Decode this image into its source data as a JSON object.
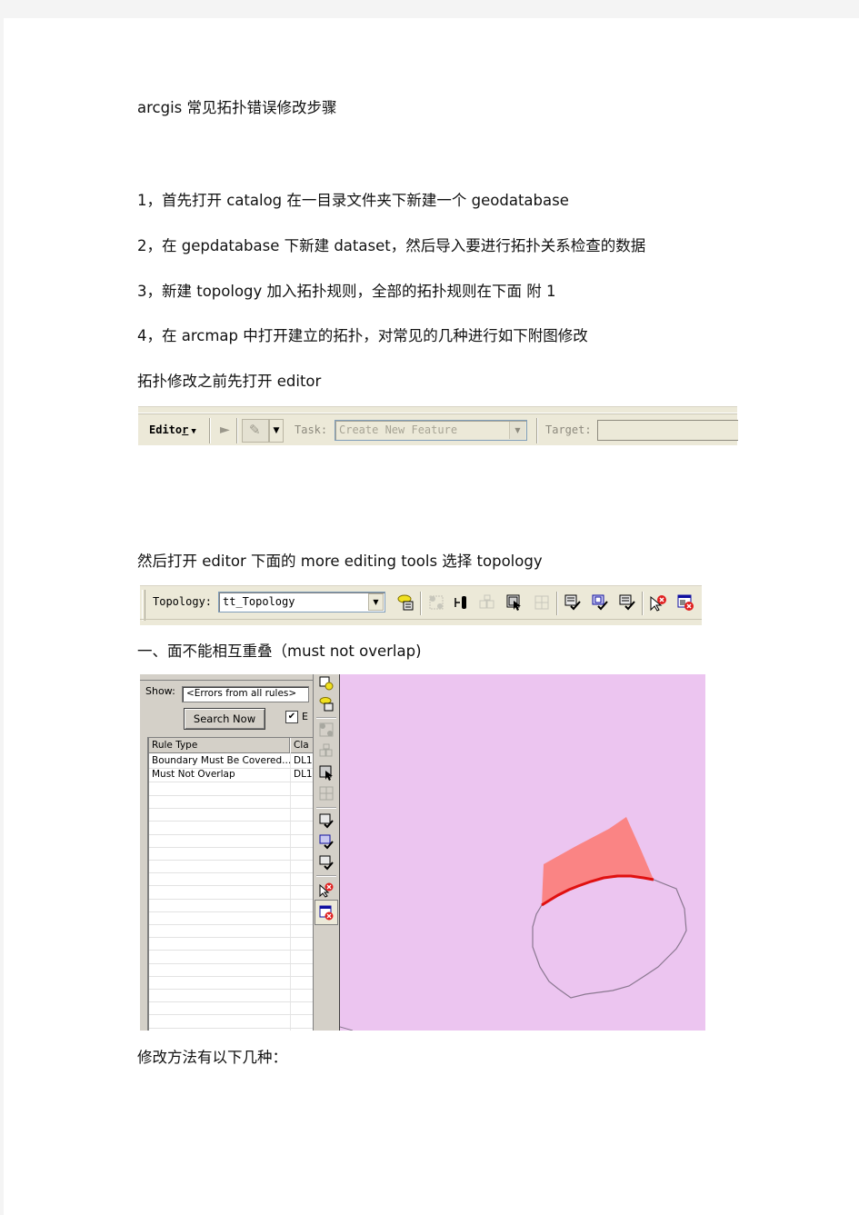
{
  "document": {
    "title": "arcgis 常见拓扑错误修改步骤",
    "steps": [
      "1，首先打开 catalog  在一目录文件夹下新建一个  geodatabase",
      "2，在 gepdatabase 下新建 dataset，然后导入要进行拓扑关系检查的数据",
      "3，新建 topology  加入拓扑规则，全部的拓扑规则在下面  附 1",
      "4，在 arcmap 中打开建立的拓扑，对常见的几种进行如下附图修改"
    ],
    "editor_note": "拓扑修改之前先打开 editor",
    "topology_note": "然后打开 editor 下面的 more  editing  tools 选择 topology",
    "section1_heading": "一、面不能相互重叠（must  not  overlap)",
    "fix_methods_label": "修改方法有以下几种："
  },
  "editor_toolbar": {
    "menu_label": "Editor",
    "menu_underline_char": "r",
    "task_label": "Task:",
    "task_value": "Create New Feature",
    "target_label": "Target:",
    "target_value": "",
    "icons": [
      "edit-tool-arrow-icon",
      "sketch-pencil-icon",
      "dropdown-arrow-icon"
    ]
  },
  "topology_toolbar": {
    "label": "Topology:",
    "selected_topology": "tt_Topology",
    "tools": [
      {
        "name": "map-topology-icon",
        "enabled": true
      },
      {
        "name": "topology-edit-tool-icon",
        "enabled": false
      },
      {
        "name": "show-shared-features-icon",
        "enabled": true
      },
      {
        "name": "construct-features-icon",
        "enabled": false
      },
      {
        "name": "fix-topology-error-icon",
        "enabled": true
      },
      {
        "name": "planarize-lines-icon",
        "enabled": false
      },
      {
        "name": "validate-topology-in-area-icon",
        "enabled": true
      },
      {
        "name": "validate-topology-visible-extent-icon",
        "enabled": true
      },
      {
        "name": "validate-entire-topology-icon",
        "enabled": true
      },
      {
        "name": "fix-error-tool-icon",
        "enabled": true
      },
      {
        "name": "error-inspector-icon",
        "enabled": true
      }
    ]
  },
  "error_inspector": {
    "show_label": "Show:",
    "show_value": "<Errors from all rules>",
    "search_button": "Search Now",
    "checkbox_checked": true,
    "checkbox_label": "E",
    "columns": [
      "Rule Type",
      "Cla"
    ],
    "rows": [
      {
        "rule_type": "Boundary Must Be Covered...",
        "class": "DL1"
      },
      {
        "rule_type": "Must Not Overlap",
        "class": "DL1"
      }
    ]
  },
  "map": {
    "background_color": "#ecc5f0",
    "overlap_fill_color": "#fa8484",
    "error_line_color": "#e01010",
    "outline_color": "#8a7890"
  }
}
